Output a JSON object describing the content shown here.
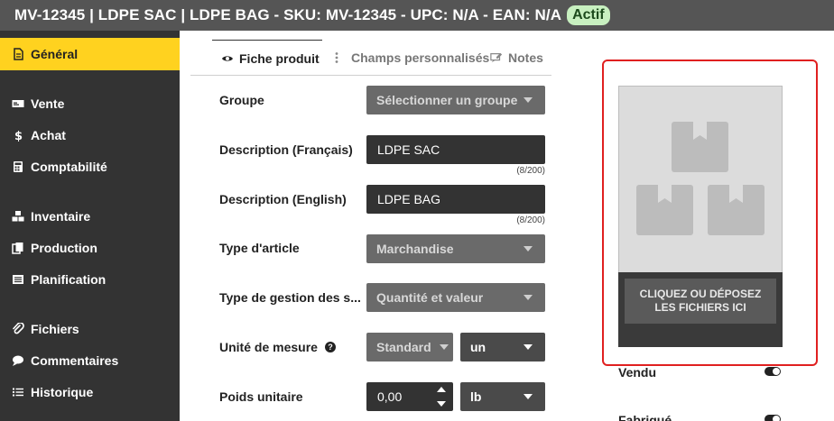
{
  "header": {
    "title": "MV-12345 | LDPE SAC | LDPE BAG - SKU: MV-12345 - UPC: N/A - EAN: N/A",
    "status_badge": "Actif"
  },
  "sidebar": {
    "items": [
      {
        "label": "Général",
        "icon": "document-icon",
        "active": true
      },
      {
        "label": "Vente",
        "icon": "cash-icon"
      },
      {
        "label": "Achat",
        "icon": "dollar-icon"
      },
      {
        "label": "Comptabilité",
        "icon": "calculator-icon"
      },
      {
        "label": "Inventaire",
        "icon": "cubes-icon"
      },
      {
        "label": "Production",
        "icon": "copy-icon"
      },
      {
        "label": "Planification",
        "icon": "list-icon"
      },
      {
        "label": "Fichiers",
        "icon": "paperclip-icon"
      },
      {
        "label": "Commentaires",
        "icon": "comment-icon"
      },
      {
        "label": "Historique",
        "icon": "history-list-icon"
      }
    ]
  },
  "tabs": [
    {
      "label": "Fiche produit",
      "icon": "eye-icon",
      "active": true
    },
    {
      "label": "Champs personnalisés",
      "icon": "vertical-ellipsis-icon"
    },
    {
      "label": "Notes",
      "icon": "note-icon"
    }
  ],
  "form": {
    "group": {
      "label": "Groupe",
      "value": "Sélectionner un groupe"
    },
    "description_fr": {
      "label": "Description (Français)",
      "value": "LDPE SAC",
      "counter": "(8/200)"
    },
    "description_en": {
      "label": "Description (English)",
      "value": "LDPE BAG",
      "counter": "(8/200)"
    },
    "item_type": {
      "label": "Type d'article",
      "value": "Marchandise"
    },
    "management_type": {
      "label": "Type de gestion des s...",
      "value": "Quantité et valeur"
    },
    "unit": {
      "label": "Unité de mesure",
      "help": "?",
      "mode": "Standard",
      "value": "un"
    },
    "weight": {
      "label": "Poids unitaire",
      "value": "0,00",
      "unit": "lb"
    }
  },
  "upload": {
    "button_label": "CLIQUEZ OU DÉPOSEZ LES FICHIERS ICI",
    "icon": "boxes-icon"
  },
  "toggles": [
    {
      "label": "Vendu",
      "on": true
    },
    {
      "label": "Fabriqué",
      "on": true
    }
  ]
}
